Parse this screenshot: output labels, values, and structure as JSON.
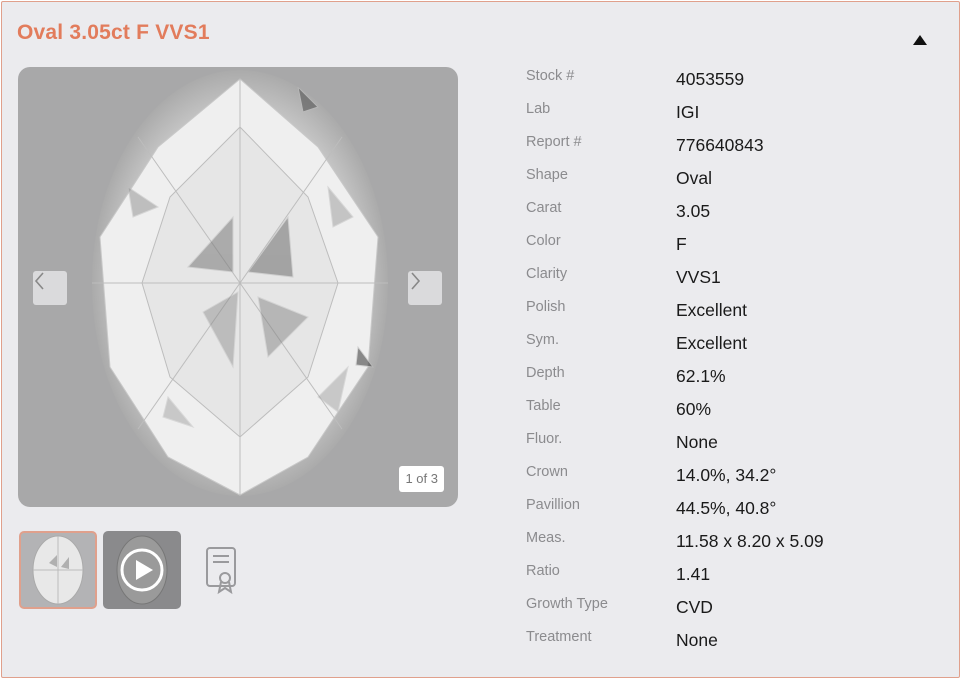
{
  "title": "Oval 3.05ct F VVS1",
  "gallery": {
    "counter": "1 of 3"
  },
  "specs": [
    {
      "label": "Stock #",
      "value": "4053559"
    },
    {
      "label": "Lab",
      "value": "IGI"
    },
    {
      "label": "Report #",
      "value": "776640843"
    },
    {
      "label": "Shape",
      "value": "Oval"
    },
    {
      "label": "Carat",
      "value": "3.05"
    },
    {
      "label": "Color",
      "value": "F"
    },
    {
      "label": "Clarity",
      "value": "VVS1"
    },
    {
      "label": "Polish",
      "value": "Excellent"
    },
    {
      "label": "Sym.",
      "value": "Excellent"
    },
    {
      "label": "Depth",
      "value": "62.1%"
    },
    {
      "label": "Table",
      "value": "60%"
    },
    {
      "label": "Fluor.",
      "value": "None"
    },
    {
      "label": "Crown",
      "value": "14.0%, 34.2°"
    },
    {
      "label": "Pavillion",
      "value": "44.5%, 40.8°"
    },
    {
      "label": "Meas.",
      "value": "11.58 x 8.20 x 5.09"
    },
    {
      "label": "Ratio",
      "value": "1.41"
    },
    {
      "label": "Growth Type",
      "value": "CVD"
    },
    {
      "label": "Treatment",
      "value": "None"
    }
  ],
  "colors": {
    "accent": "#e27c5c",
    "border": "#e0a08c",
    "panel_bg": "#ebebee"
  },
  "icons": {
    "collapse": "triangle-up-icon",
    "prev": "chevron-left-icon",
    "next": "chevron-right-icon",
    "video": "play-icon",
    "certificate": "certificate-icon"
  }
}
